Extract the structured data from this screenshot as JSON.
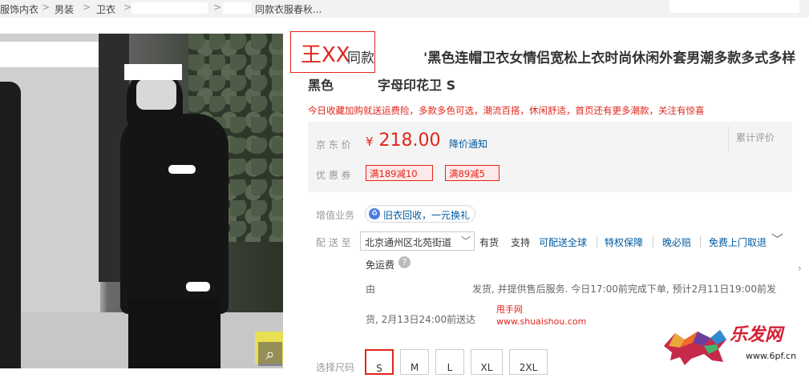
{
  "breadcrumb": {
    "items": [
      "服饰内衣",
      "男装",
      "卫衣"
    ],
    "current": "同款衣服春秋...",
    "separator": ">"
  },
  "product": {
    "title_highlight": "王XX",
    "title_line1_prefix": "同款",
    "title_line1_main": "'黑色连帽卫衣女情侣宽松上衣时尚休闲外套男潮多款多式多样",
    "title_line2_a": "黑色",
    "title_line2_b": "字母印花卫 S",
    "promo_text": "今日收藏加购就送运费险，多款多色可选，潮流百搭，休闲舒适，首页还有更多潮款，关注有惊喜"
  },
  "price_panel": {
    "price_label": "京 东 价",
    "currency": "¥",
    "price": "218.00",
    "price_notify": "降价通知",
    "review_label": "累计评价",
    "coupon_label": "优 惠 券",
    "coupons": [
      "满189减10",
      "满89减5"
    ]
  },
  "services": {
    "value_added_label": "增值业务",
    "trade_in": "旧衣回收，一元换礼",
    "delivery_label": "配 送 至",
    "address": "北京通州区北苑街道",
    "stock": "有货",
    "support_label": "支持",
    "support_links": [
      "可配送全球",
      "特权保障",
      "晚必赔",
      "免费上门取退"
    ],
    "free_shipping": "免运费",
    "ship_from_label": "由",
    "ship_info_line1": "发货, 并提供售后服务. 今日17:00前完成下单, 预计2月11日19:00前发",
    "ship_info_line2": "货, 2月13日24:00前送达"
  },
  "gallery": {
    "zoom_icon": "magnifier-icon"
  },
  "sizes": {
    "label": "选择尺码",
    "options": [
      "S",
      "M",
      "L",
      "XL",
      "2XL"
    ],
    "selected": "S"
  },
  "watermark": {
    "cn_small": "甩手网",
    "url_small": "www.shuaishou.com",
    "logo_cn": "乐发网",
    "logo_url": "www.6pf.cn"
  },
  "colors": {
    "jd_red": "#e1251b",
    "link_blue": "#005aa0",
    "panel_bg": "#f4f4f4"
  }
}
